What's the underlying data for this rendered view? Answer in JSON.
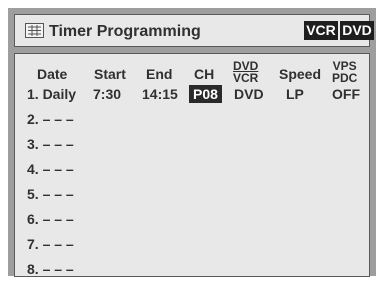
{
  "header": {
    "title": "Timer Programming",
    "tabs": [
      "VCR",
      "DVD"
    ]
  },
  "columns": {
    "date": "Date",
    "start": "Start",
    "end": "End",
    "ch": "CH",
    "media_top": "DVD",
    "media_bottom": "VCR",
    "speed": "Speed",
    "vps_top": "VPS",
    "vps_bottom": "PDC"
  },
  "programs": [
    {
      "date": "1. Daily",
      "start": "7:30",
      "end": "14:15",
      "ch": "P08",
      "media": "DVD",
      "speed": "LP",
      "vps": "OFF"
    },
    {
      "date": "2. – – –"
    },
    {
      "date": "3. – – –"
    },
    {
      "date": "4. – – –"
    },
    {
      "date": "5. – – –"
    },
    {
      "date": "6. – – –"
    },
    {
      "date": "7. – – –"
    },
    {
      "date": "8. – – –"
    }
  ],
  "icons": {
    "menu": "timer-menu-icon"
  }
}
